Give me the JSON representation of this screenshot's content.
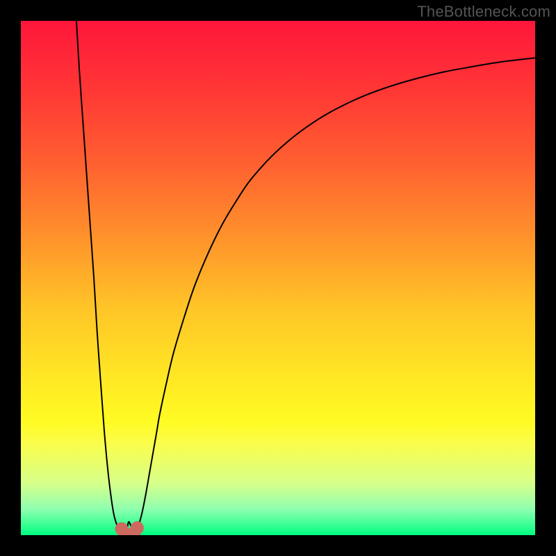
{
  "attribution": "TheBottleneck.com",
  "chart_data": {
    "type": "line",
    "title": "",
    "xlabel": "",
    "ylabel": "",
    "xlim": [
      0,
      100
    ],
    "ylim": [
      0,
      100
    ],
    "axes_visible": false,
    "legend": false,
    "background": {
      "type": "vertical-gradient",
      "stops": [
        {
          "pos": 0.0,
          "color": "#ff163b"
        },
        {
          "pos": 0.14,
          "color": "#ff3835"
        },
        {
          "pos": 0.28,
          "color": "#ff6130"
        },
        {
          "pos": 0.42,
          "color": "#ff922b"
        },
        {
          "pos": 0.56,
          "color": "#ffc527"
        },
        {
          "pos": 0.7,
          "color": "#ffe924"
        },
        {
          "pos": 0.78,
          "color": "#fffb23"
        },
        {
          "pos": 0.82,
          "color": "#fbfd4a"
        },
        {
          "pos": 0.9,
          "color": "#d6ff8a"
        },
        {
          "pos": 0.95,
          "color": "#8dffaf"
        },
        {
          "pos": 1.0,
          "color": "#00ff80"
        }
      ]
    },
    "series": [
      {
        "name": "bottleneck-curve",
        "color": "#000000",
        "stroke_width": 2,
        "x": [
          10.8,
          11.4,
          12.1,
          12.8,
          13.5,
          14.2,
          14.8,
          15.5,
          16.2,
          16.9,
          17.6,
          18.2,
          18.9,
          19.6,
          20.0,
          20.3,
          20.6,
          20.8,
          20.9,
          21.0,
          21.1,
          21.4,
          21.8,
          22.0,
          22.3,
          22.6,
          23.0,
          23.6,
          24.3,
          25.0,
          25.7,
          26.4,
          27.0,
          28.4,
          29.7,
          31.8,
          33.8,
          36.5,
          39.2,
          41.9,
          44.6,
          48.6,
          52.7,
          56.8,
          60.8,
          66.2,
          71.6,
          77.0,
          82.4,
          87.8,
          93.2,
          100.0
        ],
        "y": [
          100.0,
          90.0,
          80.0,
          70.0,
          60.0,
          50.0,
          40.0,
          30.0,
          20.5,
          12.8,
          7.0,
          3.5,
          1.5,
          0.5,
          0.2,
          0.5,
          1.2,
          2.0,
          2.5,
          2.6,
          2.5,
          1.8,
          0.8,
          0.2,
          0.3,
          1.0,
          2.2,
          4.5,
          8.0,
          12.0,
          16.0,
          20.0,
          23.5,
          30.0,
          35.5,
          42.5,
          48.5,
          55.0,
          60.5,
          65.0,
          69.0,
          73.5,
          77.2,
          80.2,
          82.6,
          85.2,
          87.2,
          88.8,
          90.1,
          91.1,
          92.0,
          92.8
        ]
      }
    ],
    "markers": [
      {
        "name": "dip-left-wall",
        "x": 19.6,
        "y": 1.2,
        "r": 1.3,
        "color": "#cc6a60"
      },
      {
        "name": "dip-left-base",
        "x": 20.1,
        "y": 0.4,
        "r": 1.3,
        "color": "#cc6a60"
      },
      {
        "name": "dip-right-base",
        "x": 22.0,
        "y": 0.4,
        "r": 1.3,
        "color": "#cc6a60"
      },
      {
        "name": "dip-right-wall",
        "x": 22.6,
        "y": 1.4,
        "r": 1.3,
        "color": "#cc6a60"
      }
    ]
  }
}
